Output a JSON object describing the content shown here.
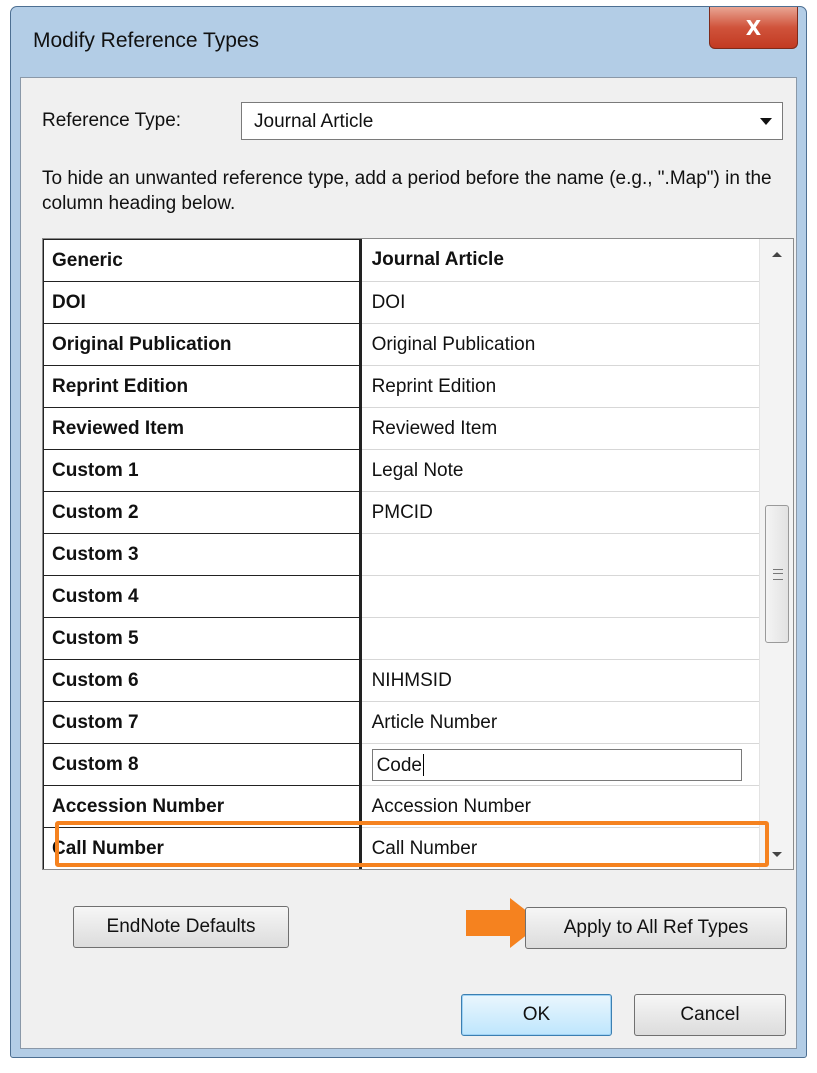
{
  "window": {
    "title": "Modify Reference Types",
    "close_label": "X"
  },
  "reference_type": {
    "label": "Reference Type:",
    "selected": "Journal Article"
  },
  "hint": "To hide an unwanted reference type, add a period before the name (e.g., \".Map\") in the column heading below.",
  "table": {
    "header": {
      "generic": "Generic",
      "ref": "Journal Article"
    },
    "rows": [
      {
        "generic": "DOI",
        "ref": "DOI"
      },
      {
        "generic": "Original Publication",
        "ref": "Original Publication"
      },
      {
        "generic": "Reprint Edition",
        "ref": "Reprint Edition"
      },
      {
        "generic": "Reviewed Item",
        "ref": "Reviewed Item"
      },
      {
        "generic": "Custom 1",
        "ref": "Legal Note"
      },
      {
        "generic": "Custom 2",
        "ref": "PMCID"
      },
      {
        "generic": "Custom 3",
        "ref": ""
      },
      {
        "generic": "Custom 4",
        "ref": ""
      },
      {
        "generic": "Custom 5",
        "ref": ""
      },
      {
        "generic": "Custom 6",
        "ref": "NIHMSID"
      },
      {
        "generic": "Custom 7",
        "ref": "Article Number"
      },
      {
        "generic": "Custom 8",
        "ref": "Code"
      },
      {
        "generic": "Accession Number",
        "ref": "Accession Number"
      },
      {
        "generic": "Call Number",
        "ref": "Call Number"
      }
    ]
  },
  "buttons": {
    "endnote_defaults": "EndNote Defaults",
    "apply_all": "Apply to All Ref Types",
    "ok": "OK",
    "cancel": "Cancel"
  },
  "colors": {
    "highlight": "#f5821f",
    "window_frame": "#b3cde6"
  }
}
